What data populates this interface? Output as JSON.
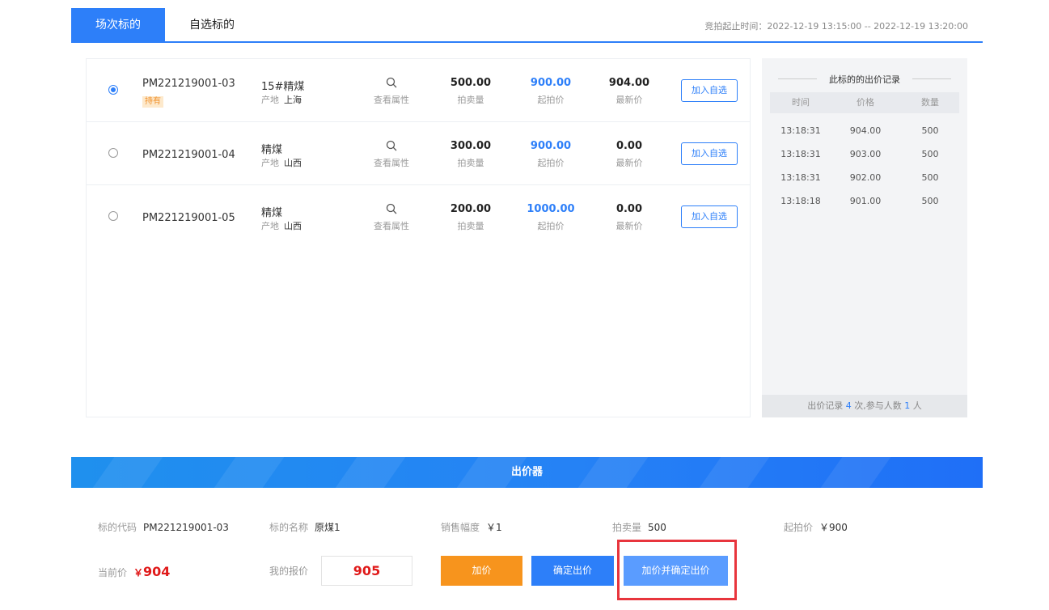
{
  "tabs": [
    {
      "label": "场次标的",
      "active": true
    },
    {
      "label": "自选标的",
      "active": false
    }
  ],
  "auction_time": "竞拍起止时间：2022-12-19 13:15:00 -- 2022-12-19 13:20:00",
  "labels": {
    "qty": "拍卖量",
    "start_price": "起拍价",
    "latest_price": "最新价",
    "view_props": "查看属性",
    "origin": "产地",
    "add_watch": "加入自选",
    "hold": "持有"
  },
  "lots": [
    {
      "code": "PM221219001-03",
      "name": "15#精煤",
      "origin": "上海",
      "qty": "500.00",
      "start_price": "900.00",
      "latest_price": "904.00",
      "selected": true,
      "hold": true
    },
    {
      "code": "PM221219001-04",
      "name": "精煤",
      "origin": "山西",
      "qty": "300.00",
      "start_price": "900.00",
      "latest_price": "0.00",
      "selected": false,
      "hold": false
    },
    {
      "code": "PM221219001-05",
      "name": "精煤",
      "origin": "山西",
      "qty": "200.00",
      "start_price": "1000.00",
      "latest_price": "0.00",
      "selected": false,
      "hold": false
    }
  ],
  "history": {
    "title": "此标的的出价记录",
    "headers": [
      "时间",
      "价格",
      "数量"
    ],
    "rows": [
      [
        "13:18:31",
        "904.00",
        "500"
      ],
      [
        "13:18:31",
        "903.00",
        "500"
      ],
      [
        "13:18:31",
        "902.00",
        "500"
      ],
      [
        "13:18:18",
        "901.00",
        "500"
      ]
    ],
    "footer_prefix": "出价记录",
    "count": "4",
    "footer_mid": "次,参与人数",
    "people": "1",
    "footer_suffix": "人"
  },
  "bidder": {
    "title": "出价器",
    "code_label": "标的代码",
    "code": "PM221219001-03",
    "name_label": "标的名称",
    "name": "原煤1",
    "step_label": "销售幅度",
    "step": "￥1",
    "qty_label": "拍卖量",
    "qty": "500",
    "start_label": "起拍价",
    "start": "￥900",
    "current_label": "当前价",
    "current_symbol": "￥",
    "current": "904",
    "my_bid_label": "我的报价",
    "my_bid": "905",
    "btn_add": "加价",
    "btn_confirm": "确定出价",
    "btn_add_confirm": "加价并确定出价"
  },
  "colors": {
    "accent": "#2d7ff9",
    "orange": "#f7941d",
    "red": "#e01a1a",
    "highlight": "#e8353d"
  }
}
